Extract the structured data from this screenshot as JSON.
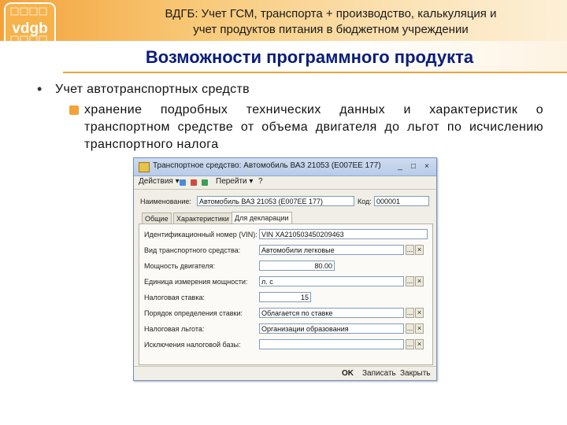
{
  "slide": {
    "header_line1": "ВДГБ: Учет ГСМ, транспорта + производство, калькуляция и",
    "header_line2": "учет продуктов питания в бюджетном учреждении",
    "logo_text": "vdgb",
    "title": "Возможности программного продукта",
    "bullet_level1": "Учет автотранспортных средств",
    "bullet_level2": "хранение подробных технических данных и характеристик о транспортном средстве от объема двигателя до льгот по исчислению транспортного налога"
  },
  "window": {
    "title": "Транспортное средство: Автомобиль ВАЗ 21053 (Е007ЕЕ 177)",
    "controls": {
      "minimize": "_",
      "maximize": "□",
      "close": "×"
    },
    "toolbar": {
      "actions": "Действия",
      "goto": "Перейти",
      "help": "?"
    },
    "name_label": "Наименование:",
    "name_value": "Автомобиль ВАЗ 21053 (Е007ЕЕ 177)",
    "code_label": "Код:",
    "code_value": "000001",
    "tabs": [
      "Общие",
      "Характеристики",
      "Для декларации"
    ],
    "active_tab": 2,
    "fields": [
      {
        "label": "Идентификационный номер (VIN):",
        "value": "VIN XA210503450209463",
        "buttons": []
      },
      {
        "label": "Вид транспортного средства:",
        "value": "Автомобили легковые",
        "buttons": [
          "...",
          "×"
        ]
      },
      {
        "label": "Мощность двигателя:",
        "value": "80.00",
        "buttons": []
      },
      {
        "label": "Единица измерения мощности:",
        "value": "л. с",
        "buttons": [
          "...",
          "×"
        ]
      },
      {
        "label": "Налоговая ставка:",
        "value": "15",
        "buttons": []
      },
      {
        "label": "Порядок определения ставки:",
        "value": "Облагается по ставке",
        "buttons": [
          "...",
          "×"
        ]
      },
      {
        "label": "Налоговая льгота:",
        "value": "Организации образования",
        "buttons": [
          "...",
          "×"
        ]
      },
      {
        "label": "Исключения налоговой базы:",
        "value": "",
        "buttons": [
          "...",
          "×"
        ]
      }
    ],
    "bottom": {
      "ok": "OK",
      "save": "Записать",
      "close": "Закрыть"
    }
  }
}
